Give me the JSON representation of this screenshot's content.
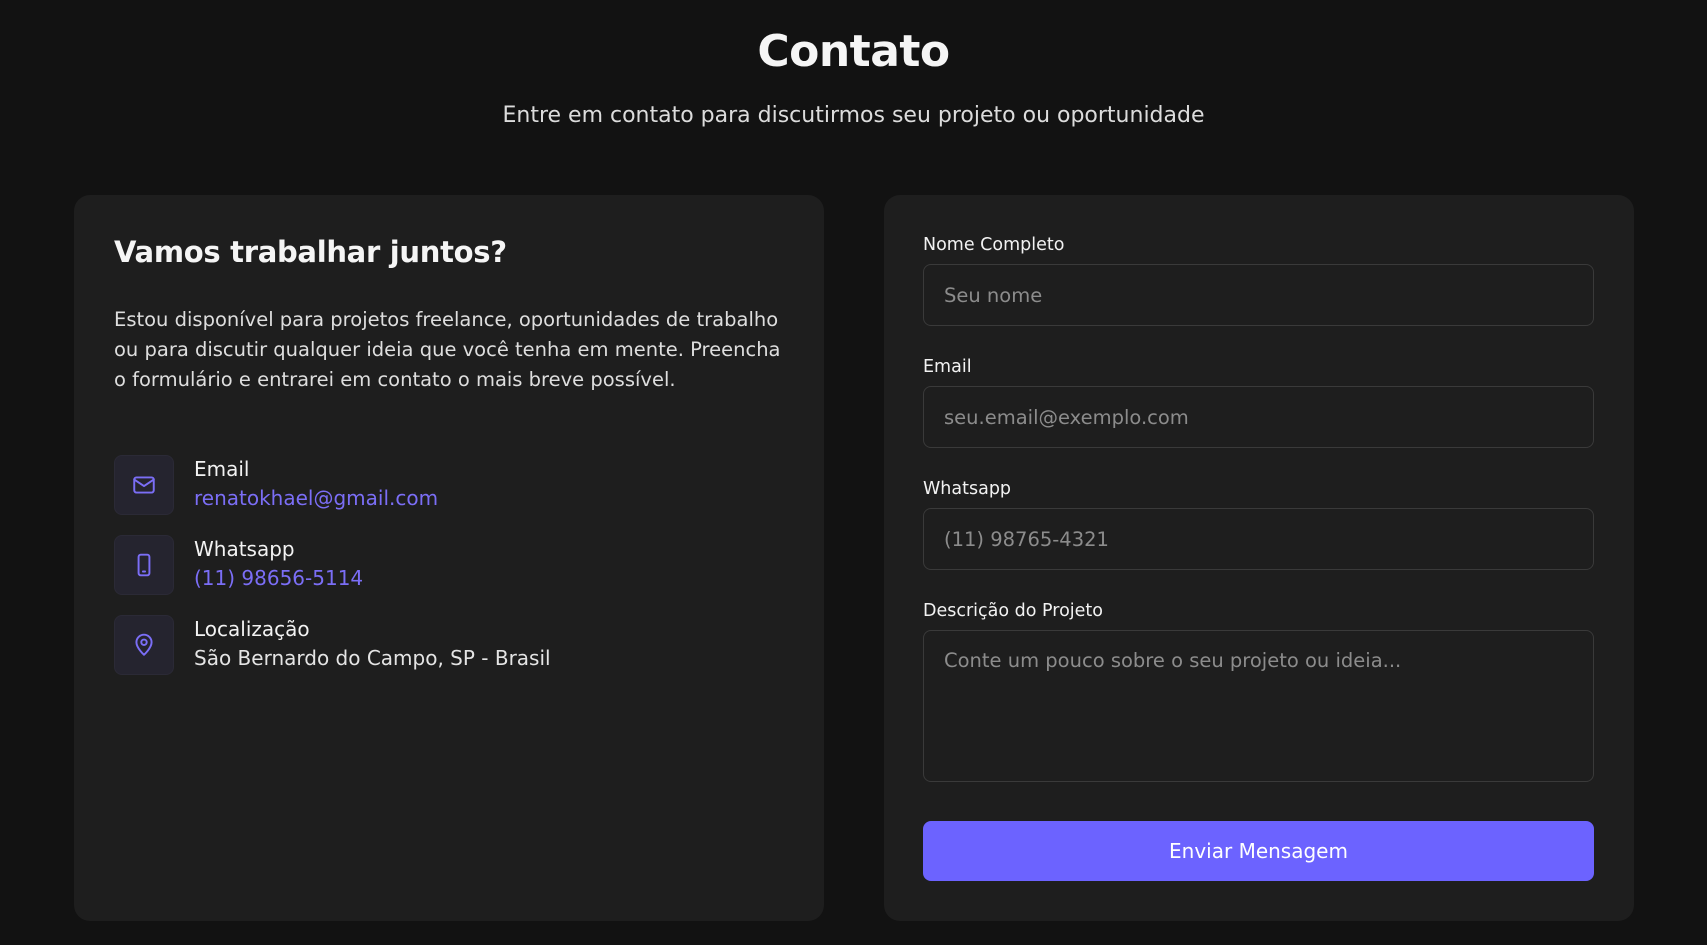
{
  "header": {
    "title": "Contato",
    "subtitle": "Entre em contato para discutirmos seu projeto ou oportunidade"
  },
  "info": {
    "heading": "Vamos trabalhar juntos?",
    "description": "Estou disponível para projetos freelance, oportunidades de trabalho ou para discutir qualquer ideia que você tenha em mente. Preencha o formulário e entrarei em contato o mais breve possível.",
    "items": [
      {
        "icon": "mail-icon",
        "label": "Email",
        "value": "renatokhael@gmail.com"
      },
      {
        "icon": "smartphone-icon",
        "label": "Whatsapp",
        "value": "(11) 98656-5114"
      },
      {
        "icon": "map-pin-icon",
        "label": "Localização",
        "value": "São Bernardo do Campo, SP - Brasil"
      }
    ]
  },
  "form": {
    "name_label": "Nome Completo",
    "name_placeholder": "Seu nome",
    "email_label": "Email",
    "email_placeholder": "seu.email@exemplo.com",
    "whatsapp_label": "Whatsapp",
    "whatsapp_placeholder": "(11) 98765-4321",
    "description_label": "Descrição do Projeto",
    "description_placeholder": "Conte um pouco sobre o seu projeto ou ideia...",
    "submit_label": "Enviar Mensagem"
  },
  "colors": {
    "background": "#121212",
    "card": "#1e1e1e",
    "accent": "#6c63ff",
    "link": "#7b6ef6"
  }
}
